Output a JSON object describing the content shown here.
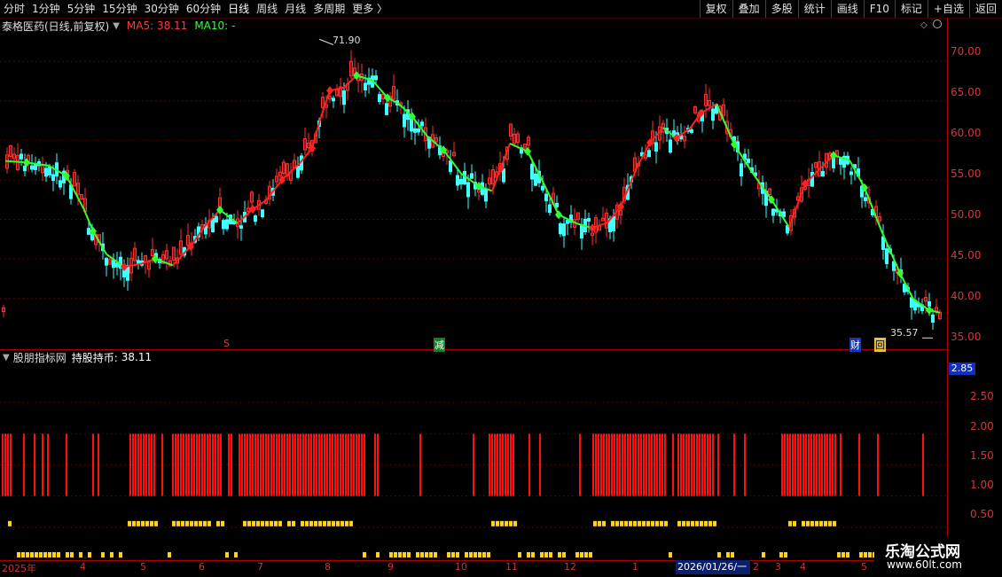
{
  "toolbar": {
    "periods": [
      "分时",
      "1分钟",
      "5分钟",
      "15分钟",
      "30分钟",
      "60分钟",
      "日线",
      "周线",
      "月线",
      "多周期",
      "更多 〉"
    ],
    "active_period": "日线",
    "right_buttons": [
      "复权",
      "叠加",
      "多股",
      "统计",
      "画线",
      "F10",
      "标记",
      "+自选",
      "返回"
    ]
  },
  "stock": {
    "title": "泰格医药(日线,前复权)",
    "ma5": "MA5: 38.11",
    "ma10": "MA10: -"
  },
  "price_axis": {
    "labels": [
      "70.00",
      "65.00",
      "60.00",
      "55.00",
      "50.00",
      "45.00",
      "40.00",
      "35.00"
    ]
  },
  "price_extremes": {
    "high": "71.90",
    "low": "35.57"
  },
  "chart_data": {
    "type": "candlestick",
    "price_range": [
      33.8,
      73.5
    ],
    "ma_points": [
      [
        6,
        57.4
      ],
      [
        30,
        57.2
      ],
      [
        55,
        56.8
      ],
      [
        75,
        55.5
      ],
      [
        95,
        51.2
      ],
      [
        105,
        48.5
      ],
      [
        120,
        45.6
      ],
      [
        140,
        44.0
      ],
      [
        160,
        44.4
      ],
      [
        175,
        45.0
      ],
      [
        195,
        44.2
      ],
      [
        215,
        46.6
      ],
      [
        230,
        49.0
      ],
      [
        248,
        51.2
      ],
      [
        268,
        49.5
      ],
      [
        285,
        51.3
      ],
      [
        300,
        52.4
      ],
      [
        318,
        55.0
      ],
      [
        338,
        57.1
      ],
      [
        352,
        59.0
      ],
      [
        362,
        63.0
      ],
      [
        372,
        66.3
      ],
      [
        388,
        66.7
      ],
      [
        402,
        68.2
      ],
      [
        420,
        67.6
      ],
      [
        437,
        65.4
      ],
      [
        450,
        64.6
      ],
      [
        465,
        63.0
      ],
      [
        482,
        60.5
      ],
      [
        500,
        58.8
      ],
      [
        520,
        55.8
      ],
      [
        540,
        54.2
      ],
      [
        555,
        53.6
      ],
      [
        565,
        56.5
      ],
      [
        575,
        59.6
      ],
      [
        595,
        58.6
      ],
      [
        612,
        54.8
      ],
      [
        630,
        50.6
      ],
      [
        650,
        49.5
      ],
      [
        668,
        48.9
      ],
      [
        685,
        49.6
      ],
      [
        700,
        51.6
      ],
      [
        718,
        56.5
      ],
      [
        733,
        59.7
      ],
      [
        748,
        61.6
      ],
      [
        763,
        60.3
      ],
      [
        778,
        61.5
      ],
      [
        790,
        63.4
      ],
      [
        808,
        64.6
      ],
      [
        828,
        59.5
      ],
      [
        848,
        56.0
      ],
      [
        870,
        52.5
      ],
      [
        890,
        49.0
      ],
      [
        908,
        54.5
      ],
      [
        922,
        56.1
      ],
      [
        940,
        58.1
      ],
      [
        958,
        57.5
      ],
      [
        975,
        54.0
      ],
      [
        995,
        48.3
      ],
      [
        1015,
        43.2
      ],
      [
        1030,
        39.9
      ],
      [
        1048,
        38.5
      ],
      [
        1060,
        38.2
      ]
    ],
    "ma_colors": [
      "#ff2020",
      "#32ff32"
    ],
    "indicator_name": "股朋指标网",
    "indicator_label": "持股持币:",
    "indicator_value": "38.11",
    "indicator_axis": [
      "2.85",
      "2.50",
      "2.00",
      "1.50",
      "1.00",
      "0.50"
    ],
    "indicator_range": [
      0,
      3.1
    ],
    "sub_markers": [
      "S",
      "减",
      "财",
      "回"
    ]
  },
  "dates": {
    "labels": [
      "2025年",
      "4",
      "5",
      "6",
      "7",
      "8",
      "9",
      "10",
      "11",
      "12",
      "1",
      "2",
      "3",
      "4",
      "5"
    ],
    "highlight": "2026/01/26/一"
  },
  "watermark": {
    "line1": "乐淘公式网",
    "line2": "www.60lt.com"
  }
}
